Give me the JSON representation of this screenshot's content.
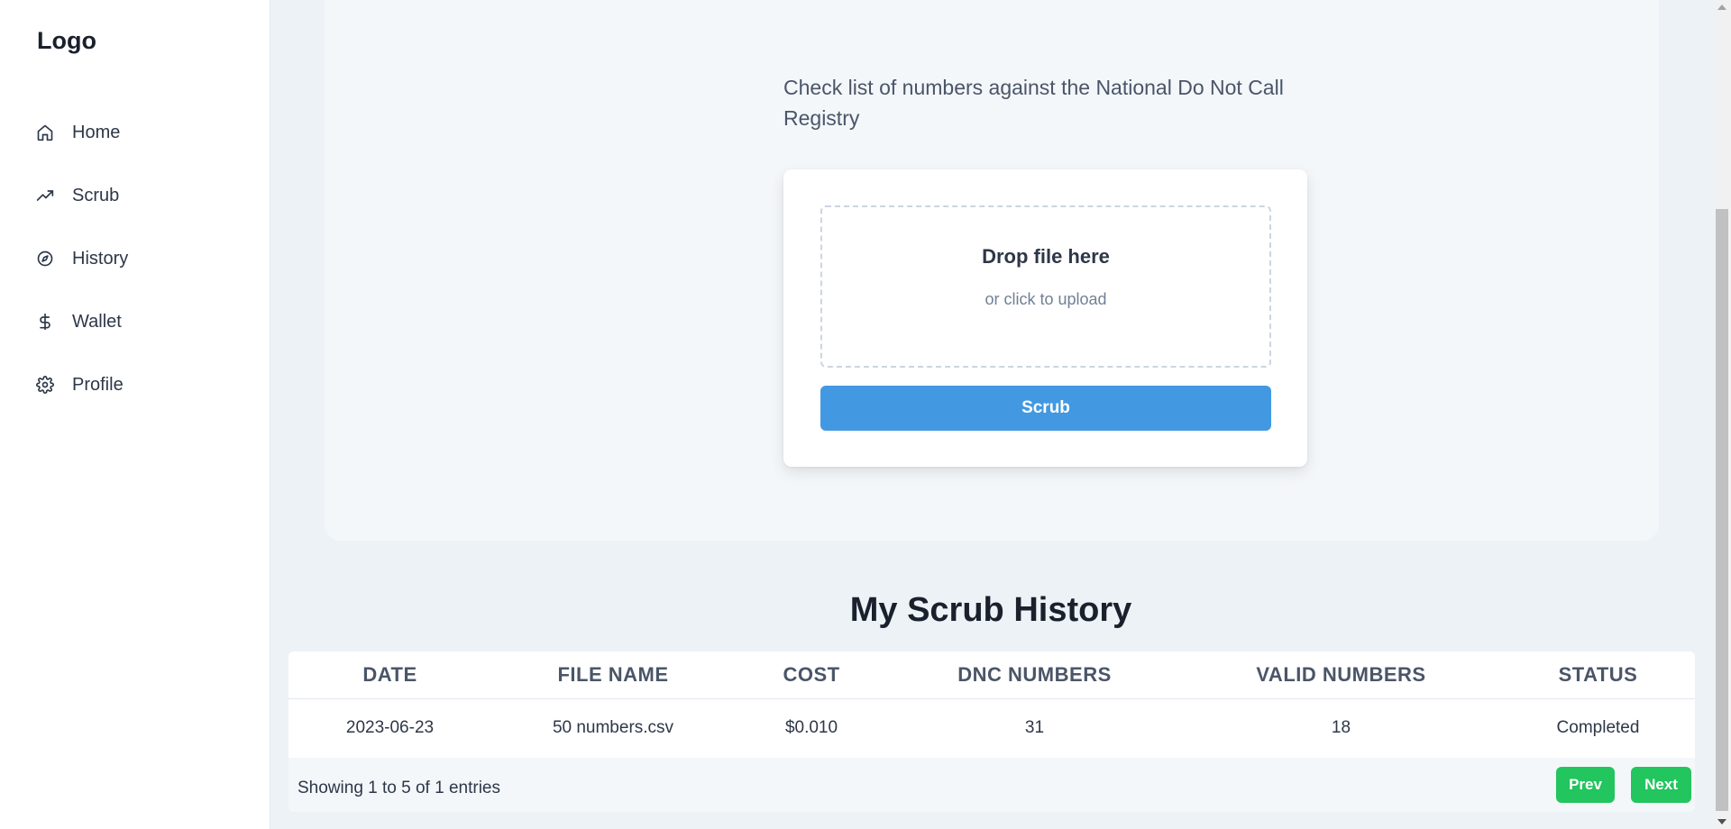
{
  "sidebar": {
    "logo": "Logo",
    "items": [
      {
        "label": "Home",
        "icon": "home-icon"
      },
      {
        "label": "Scrub",
        "icon": "trending-up-icon"
      },
      {
        "label": "History",
        "icon": "compass-icon"
      },
      {
        "label": "Wallet",
        "icon": "dollar-icon"
      },
      {
        "label": "Profile",
        "icon": "gear-icon"
      }
    ]
  },
  "upload": {
    "subtitle": "Check list of numbers against the National Do Not Call Registry",
    "drop_title": "Drop file here",
    "drop_sub": "or click to upload",
    "scrub_button": "Scrub"
  },
  "history": {
    "title": "My Scrub History",
    "columns": [
      "DATE",
      "FILE NAME",
      "COST",
      "DNC NUMBERS",
      "VALID NUMBERS",
      "STATUS"
    ],
    "rows": [
      {
        "date": "2023-06-23",
        "file_name": "50 numbers.csv",
        "cost": "$0.010",
        "dnc": "31",
        "valid": "18",
        "status": "Completed"
      }
    ],
    "entries_text": "Showing 1 to 5 of 1 entries",
    "prev_label": "Prev",
    "next_label": "Next"
  },
  "colors": {
    "primary": "#4299e1",
    "pagination": "#22c55e",
    "background": "#edf2f7"
  }
}
